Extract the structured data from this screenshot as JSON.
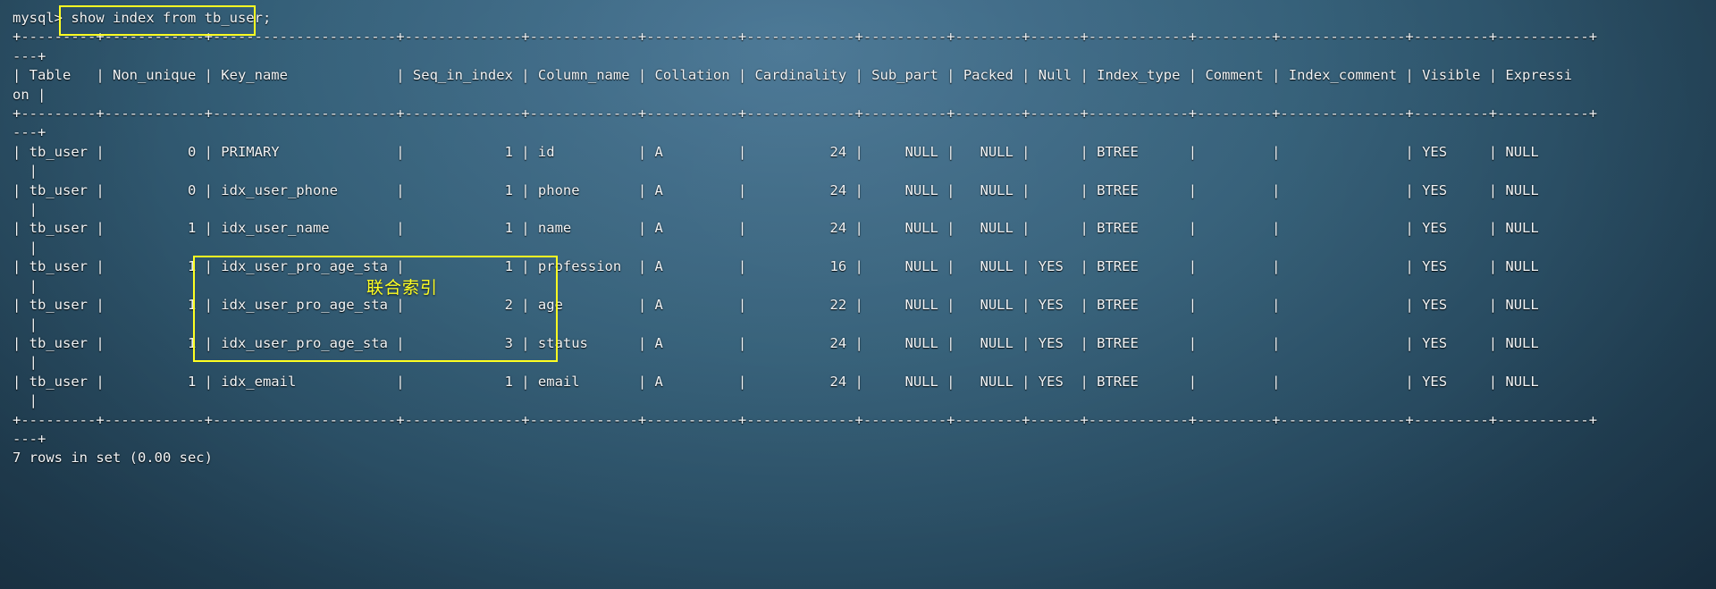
{
  "terminal": {
    "prompt": "mysql>",
    "command": "show index from tb_user;",
    "status_line": "7 rows in set (0.00 sec)",
    "separator_main": "+---------+------------+----------------------+--------------+-------------+-----------+-------------+----------+--------+------+------------+---------+---------------+---------+-----------+",
    "separator_wrap": "---+",
    "header_line": "| Table   | Non_unique | Key_name             | Seq_in_index | Column_name | Collation | Cardinality | Sub_part | Packed | Null | Index_type | Comment | Index_comment | Visible | Expressi",
    "header_wrap": "on |"
  },
  "annotation": {
    "composite_index_label": "联合索引",
    "highlight_color": "#ffff22"
  },
  "table": {
    "columns": [
      "Table",
      "Non_unique",
      "Key_name",
      "Seq_in_index",
      "Column_name",
      "Collation",
      "Cardinality",
      "Sub_part",
      "Packed",
      "Null",
      "Index_type",
      "Comment",
      "Index_comment",
      "Visible",
      "Expression"
    ],
    "rows": [
      {
        "Table": "tb_user",
        "Non_unique": "0",
        "Key_name": "PRIMARY",
        "Seq_in_index": "1",
        "Column_name": "id",
        "Collation": "A",
        "Cardinality": "24",
        "Sub_part": "NULL",
        "Packed": "NULL",
        "Null": "",
        "Index_type": "BTREE",
        "Comment": "",
        "Index_comment": "",
        "Visible": "YES",
        "Expression": "NULL",
        "highlighted": false
      },
      {
        "Table": "tb_user",
        "Non_unique": "0",
        "Key_name": "idx_user_phone",
        "Seq_in_index": "1",
        "Column_name": "phone",
        "Collation": "A",
        "Cardinality": "24",
        "Sub_part": "NULL",
        "Packed": "NULL",
        "Null": "",
        "Index_type": "BTREE",
        "Comment": "",
        "Index_comment": "",
        "Visible": "YES",
        "Expression": "NULL",
        "highlighted": false
      },
      {
        "Table": "tb_user",
        "Non_unique": "1",
        "Key_name": "idx_user_name",
        "Seq_in_index": "1",
        "Column_name": "name",
        "Collation": "A",
        "Cardinality": "24",
        "Sub_part": "NULL",
        "Packed": "NULL",
        "Null": "",
        "Index_type": "BTREE",
        "Comment": "",
        "Index_comment": "",
        "Visible": "YES",
        "Expression": "NULL",
        "highlighted": false
      },
      {
        "Table": "tb_user",
        "Non_unique": "1",
        "Key_name": "idx_user_pro_age_sta",
        "Seq_in_index": "1",
        "Column_name": "profession",
        "Collation": "A",
        "Cardinality": "16",
        "Sub_part": "NULL",
        "Packed": "NULL",
        "Null": "YES",
        "Index_type": "BTREE",
        "Comment": "",
        "Index_comment": "",
        "Visible": "YES",
        "Expression": "NULL",
        "highlighted": true
      },
      {
        "Table": "tb_user",
        "Non_unique": "1",
        "Key_name": "idx_user_pro_age_sta",
        "Seq_in_index": "2",
        "Column_name": "age",
        "Collation": "A",
        "Cardinality": "22",
        "Sub_part": "NULL",
        "Packed": "NULL",
        "Null": "YES",
        "Index_type": "BTREE",
        "Comment": "",
        "Index_comment": "",
        "Visible": "YES",
        "Expression": "NULL",
        "highlighted": true
      },
      {
        "Table": "tb_user",
        "Non_unique": "1",
        "Key_name": "idx_user_pro_age_sta",
        "Seq_in_index": "3",
        "Column_name": "status",
        "Collation": "A",
        "Cardinality": "24",
        "Sub_part": "NULL",
        "Packed": "NULL",
        "Null": "YES",
        "Index_type": "BTREE",
        "Comment": "",
        "Index_comment": "",
        "Visible": "YES",
        "Expression": "NULL",
        "highlighted": true
      },
      {
        "Table": "tb_user",
        "Non_unique": "1",
        "Key_name": "idx_email",
        "Seq_in_index": "1",
        "Column_name": "email",
        "Collation": "A",
        "Cardinality": "24",
        "Sub_part": "NULL",
        "Packed": "NULL",
        "Null": "YES",
        "Index_type": "BTREE",
        "Comment": "",
        "Index_comment": "",
        "Visible": "YES",
        "Expression": "NULL",
        "highlighted": false
      }
    ]
  }
}
